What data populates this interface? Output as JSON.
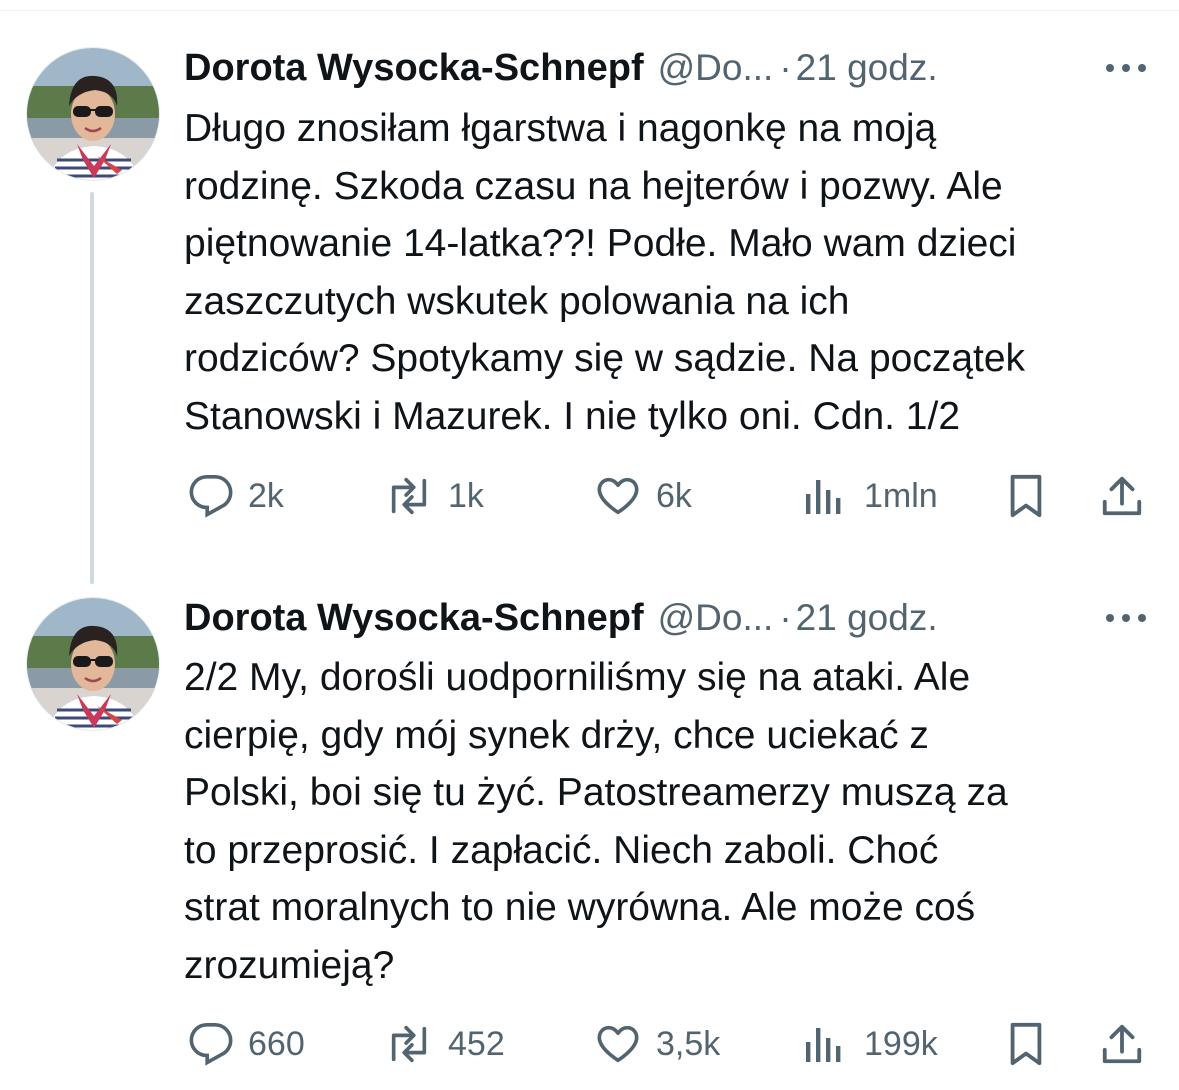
{
  "tweets": [
    {
      "display_name": "Dorota Wysocka-Schnepf",
      "handle": "@Do...",
      "separator": "·",
      "time": "21 godz.",
      "text": "Długo znosiłam łgarstwa i nagonkę na moją\nrodzinę. Szkoda czasu na hejterów i pozwy. Ale\npiętnowanie 14-latka??! Podłe. Mało wam dzieci\nzaszczutych wskutek polowania na ich\nrodziców? Spotykamy się w sądzie. Na początek\nStanowski i Mazurek. I nie tylko oni. Cdn. 1/2",
      "replies": "2k",
      "reposts": "1k",
      "likes": "6k",
      "views": "1mln"
    },
    {
      "display_name": "Dorota Wysocka-Schnepf",
      "handle": "@Do...",
      "separator": "·",
      "time": "21 godz.",
      "text": "2/2 My, dorośli uodporniliśmy się na ataki. Ale\ncierpię, gdy mój synek drży, chce uciekać z\nPolski, boi się tu żyć. Patostreamerzy muszą za\nto przeprosić. I zapłacić. Niech zaboli. Choć\nstrat moralnych to nie wyrówna. Ale może coś\nzrozumieją?",
      "replies": "660",
      "reposts": "452",
      "likes": "3,5k",
      "views": "199k"
    }
  ],
  "icons": {
    "reply": "speech-bubble-icon",
    "repost": "repost-arrows-icon",
    "like": "heart-icon",
    "views": "bar-chart-icon",
    "bookmark": "bookmark-icon",
    "share": "share-upload-icon",
    "more": "ellipsis-icon"
  },
  "colors": {
    "text_primary": "#0f1419",
    "text_secondary": "#536471",
    "thread_line": "#cfd9de"
  }
}
